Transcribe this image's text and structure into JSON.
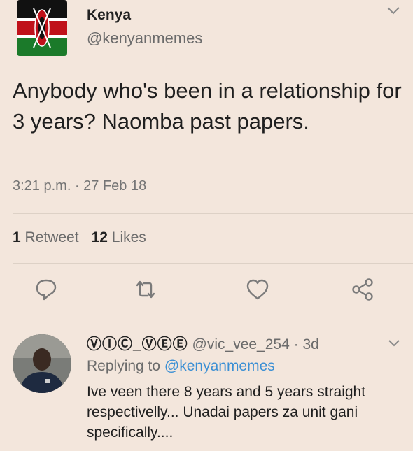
{
  "tweet": {
    "account_name": "Kenya",
    "handle": "@kenyanmemes",
    "text": "Anybody who's been in a relationship for 3 years? Naomba past papers.",
    "timestamp": "3:21 p.m. · 27 Feb 18",
    "retweet_count": "1",
    "retweet_label": "Retweet",
    "likes_count": "12",
    "likes_label": "Likes"
  },
  "actions": {
    "icons": [
      "reply-icon",
      "retweet-icon",
      "like-icon",
      "share-icon"
    ]
  },
  "reply": {
    "display_name": "ⓋⒾⒸ_ⓋⒺⒺ",
    "handle": "@vic_vee_254",
    "age": "· 3d",
    "replying_prefix": "Replying to",
    "replying_to": "@kenyanmemes",
    "text": "Ive veen there 8 years and 5 years straight respectivelly... Unadai papers za unit gani specifically...."
  },
  "colors": {
    "background": "#f3e6dc",
    "link": "#3b8fd4",
    "muted_text": "#6b6b6b",
    "icon": "#7a7a7a"
  }
}
